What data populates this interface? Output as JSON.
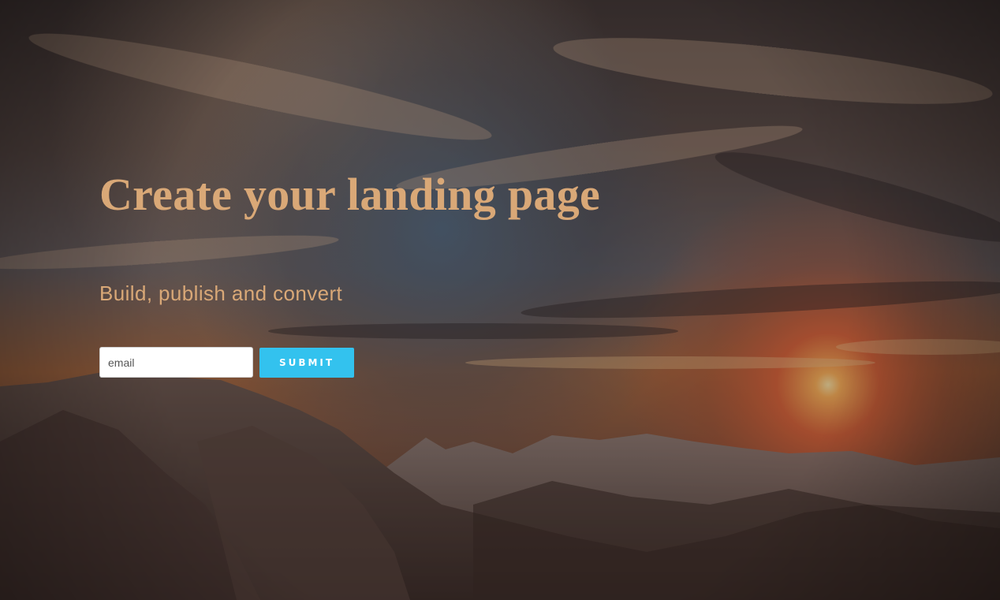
{
  "hero": {
    "headline": "Create your landing page",
    "subheadline": "Build, publish and convert",
    "background_image": "sunset-over-mountains"
  },
  "form": {
    "email_placeholder": "email",
    "email_value": "",
    "submit_label": "SUBMIT"
  },
  "colors": {
    "headline": "#d9a877",
    "subheadline": "#d9a877",
    "submit_button": "#33c2ee",
    "submit_text": "#ffffff"
  }
}
